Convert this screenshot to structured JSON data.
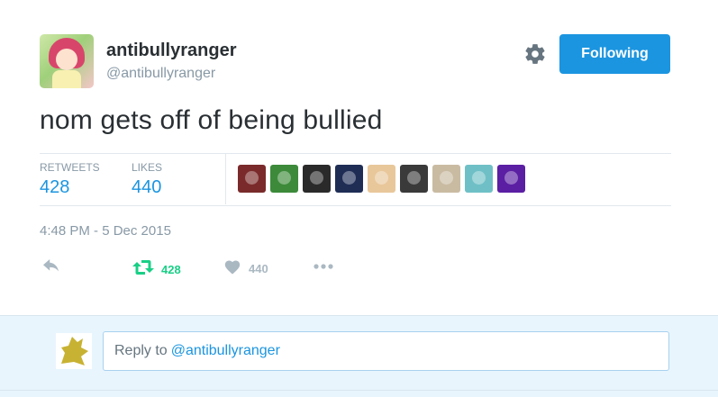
{
  "user": {
    "display_name": "antibullyranger",
    "handle": "@antibullyranger",
    "follow_button": "Following"
  },
  "tweet": {
    "text": "nom gets off of being bullied",
    "timestamp": "4:48 PM - 5 Dec 2015"
  },
  "stats": {
    "retweets_label": "RETWEETS",
    "retweets_value": "428",
    "likes_label": "LIKES",
    "likes_value": "440"
  },
  "likers": [
    {
      "name": "liker-1",
      "color": "#7a2a2a"
    },
    {
      "name": "liker-2",
      "color": "#3c8a3a"
    },
    {
      "name": "liker-3",
      "color": "#2a2a2a"
    },
    {
      "name": "liker-4",
      "color": "#1f2d55"
    },
    {
      "name": "liker-5",
      "color": "#e8c79a"
    },
    {
      "name": "liker-6",
      "color": "#3a3a3a"
    },
    {
      "name": "liker-7",
      "color": "#c9bba2"
    },
    {
      "name": "liker-8",
      "color": "#6fc0c6"
    },
    {
      "name": "liker-9",
      "color": "#5a1fa3"
    }
  ],
  "actions": {
    "retweet_count": "428",
    "like_count": "440"
  },
  "colors": {
    "accent": "#1b95e0",
    "retweet_active": "#19cf86",
    "muted": "#8899a6"
  },
  "reply": {
    "prefix": "Reply to",
    "mention": "@antibullyranger"
  }
}
